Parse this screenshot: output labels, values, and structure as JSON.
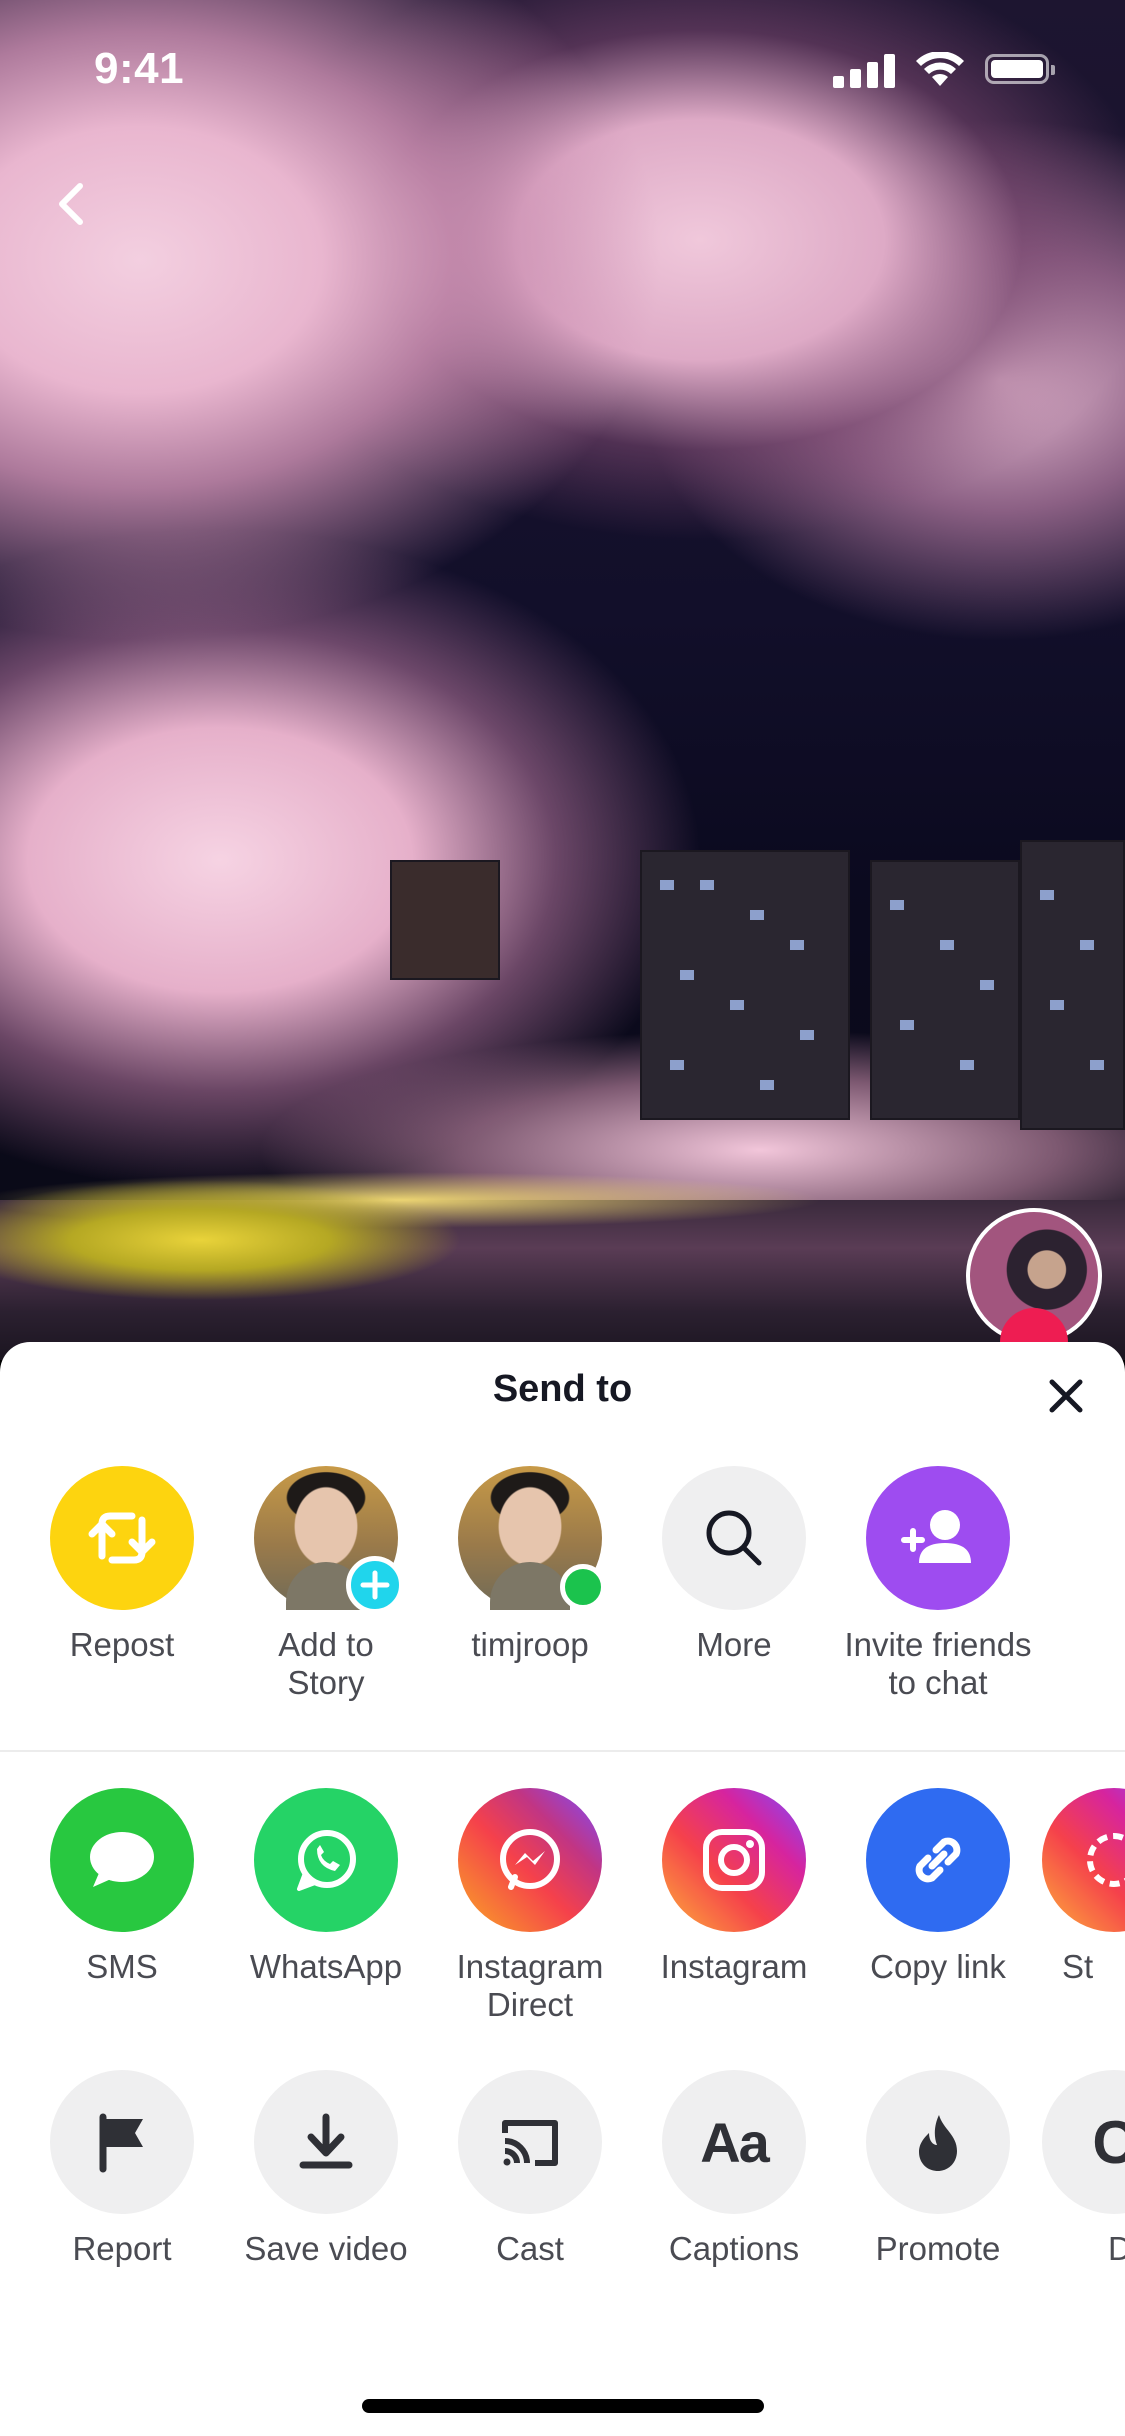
{
  "status_bar": {
    "time": "9:41"
  },
  "sheet": {
    "title": "Send to",
    "row1": [
      {
        "label": "Repost",
        "icon": "repost-icon",
        "color": "#fdd40f"
      },
      {
        "label": "Add to\nStory",
        "icon": "story-avatar"
      },
      {
        "label": "timjroop",
        "icon": "user-avatar"
      },
      {
        "label": "More",
        "icon": "search-icon"
      },
      {
        "label": "Invite friends\nto chat",
        "icon": "add-friend-icon",
        "color": "#9e4cf0"
      }
    ],
    "row2": [
      {
        "label": "SMS",
        "icon": "sms-icon",
        "color": "#28c840"
      },
      {
        "label": "WhatsApp",
        "icon": "whatsapp-icon",
        "color": "#25d366"
      },
      {
        "label": "Instagram\nDirect",
        "icon": "messenger-icon"
      },
      {
        "label": "Instagram",
        "icon": "instagram-icon"
      },
      {
        "label": "Copy link",
        "icon": "link-icon",
        "color": "#2f6bf1"
      },
      {
        "label": "St",
        "icon": "stories-icon"
      }
    ],
    "row3": [
      {
        "label": "Report",
        "icon": "flag-icon"
      },
      {
        "label": "Save video",
        "icon": "download-icon"
      },
      {
        "label": "Cast",
        "icon": "cast-icon"
      },
      {
        "label": "Captions",
        "icon": "captions-icon",
        "glyph": "Aa"
      },
      {
        "label": "Promote",
        "icon": "flame-icon"
      },
      {
        "label": "D",
        "icon": "partial-icon",
        "glyph": "C"
      }
    ]
  }
}
